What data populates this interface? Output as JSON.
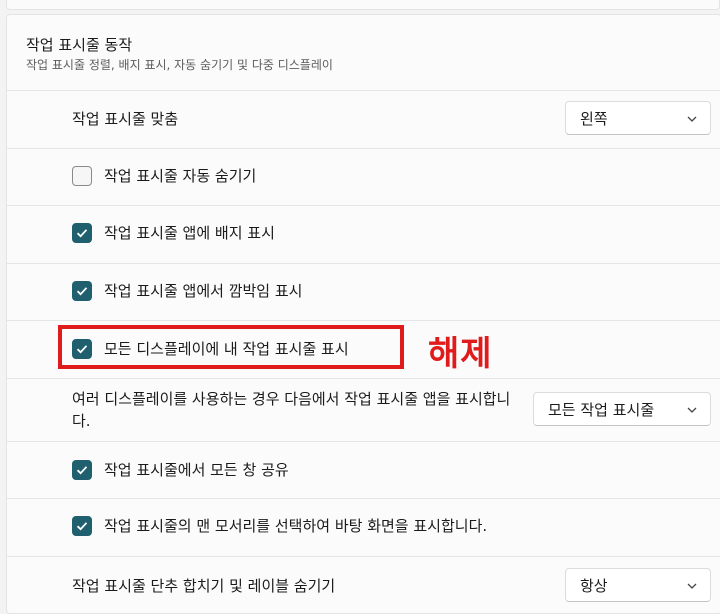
{
  "section": {
    "title": "작업 표시줄 동작",
    "subtitle": "작업 표시줄 정렬, 배지 표시, 자동 숨기기 및 다중 디스플레이"
  },
  "alignment": {
    "label": "작업 표시줄 맞춤",
    "value": "왼쪽"
  },
  "auto_hide": {
    "label": "작업 표시줄 자동 숨기기",
    "checked": false
  },
  "badges": {
    "label": "작업 표시줄 앱에 배지 표시",
    "checked": true
  },
  "flashing": {
    "label": "작업 표시줄 앱에서 깜박임 표시",
    "checked": true
  },
  "all_displays": {
    "label": "모든 디스플레이에 내 작업 표시줄 표시",
    "checked": true
  },
  "annotation": {
    "text": "해제",
    "color": "#e01b1b"
  },
  "multi_display": {
    "label": "여러 디스플레이를 사용하는 경우 다음에서 작업 표시줄 앱을 표시합니다.",
    "value": "모든 작업 표시줄"
  },
  "share_windows": {
    "label": "작업 표시줄에서 모든 창 공유",
    "checked": true
  },
  "far_corner": {
    "label": "작업 표시줄의 맨 모서리를 선택하여 바탕 화면을 표시합니다.",
    "checked": true
  },
  "combine": {
    "label": "작업 표시줄 단추 합치기 및 레이블 숨기기",
    "value": "항상"
  },
  "colors": {
    "accent": "#1f5f6e",
    "annotation": "#e01b1b"
  }
}
